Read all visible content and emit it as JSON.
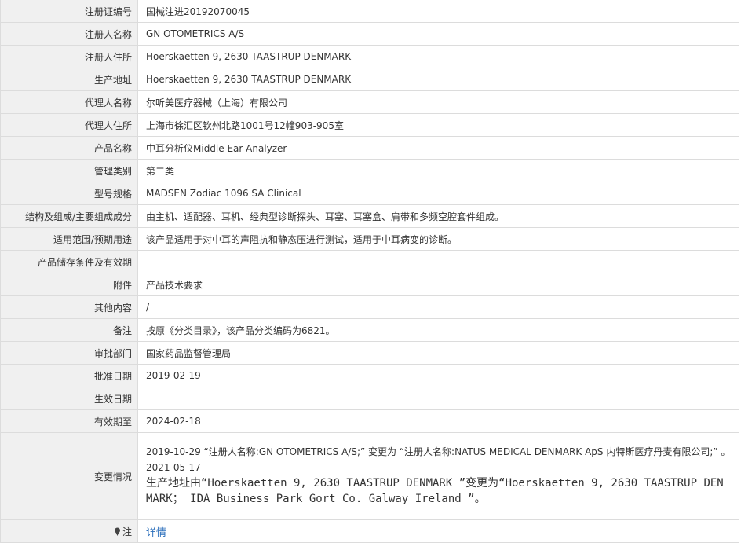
{
  "rows": [
    {
      "label": "注册证编号",
      "value": "国械注进20192070045"
    },
    {
      "label": "注册人名称",
      "value": "GN OTOMETRICS A/S"
    },
    {
      "label": "注册人住所",
      "value": "Hoerskaetten 9, 2630 TAASTRUP DENMARK"
    },
    {
      "label": "生产地址",
      "value": "Hoerskaetten 9, 2630 TAASTRUP DENMARK"
    },
    {
      "label": "代理人名称",
      "value": "尔听美医疗器械（上海）有限公司"
    },
    {
      "label": "代理人住所",
      "value": "上海市徐汇区钦州北路1001号12幢903-905室"
    },
    {
      "label": "产品名称",
      "value": "中耳分析仪Middle Ear Analyzer"
    },
    {
      "label": "管理类别",
      "value": "第二类"
    },
    {
      "label": "型号规格",
      "value": "MADSEN Zodiac 1096 SA Clinical"
    },
    {
      "label": "结构及组成/主要组成成分",
      "value": "由主机、适配器、耳机、经典型诊断探头、耳塞、耳塞盒、肩带和多频空腔套件组成。"
    },
    {
      "label": "适用范围/预期用途",
      "value": "该产品适用于对中耳的声阻抗和静态压进行测试，适用于中耳病变的诊断。"
    },
    {
      "label": "产品储存条件及有效期",
      "value": ""
    },
    {
      "label": "附件",
      "value": "产品技术要求"
    },
    {
      "label": "其他内容",
      "value": "/"
    },
    {
      "label": "备注",
      "value": "按原《分类目录》，该产品分类编码为6821。"
    },
    {
      "label": "审批部门",
      "value": "国家药品监督管理局"
    },
    {
      "label": "批准日期",
      "value": "2019-02-19"
    },
    {
      "label": "生效日期",
      "value": ""
    },
    {
      "label": "有效期至",
      "value": "2024-02-18"
    }
  ],
  "changes": {
    "label": "变更情况",
    "entry1": "2019-10-29 “注册人名称:GN OTOMETRICS A/S;” 变更为 “注册人名称:NATUS MEDICAL DENMARK ApS 内特斯医疗丹麦有限公司;” 。",
    "date2": "2021-05-17",
    "entry2": "生产地址由“Hoerskaetten 9, 2630 TAASTRUP DENMARK ”变更为“Hoerskaetten 9, 2630 TAASTRUP DENMARK； IDA Business Park Gort Co. Galway Ireland ”。"
  },
  "note": {
    "label": "注",
    "link": "详情",
    "icon": "pin-icon"
  }
}
